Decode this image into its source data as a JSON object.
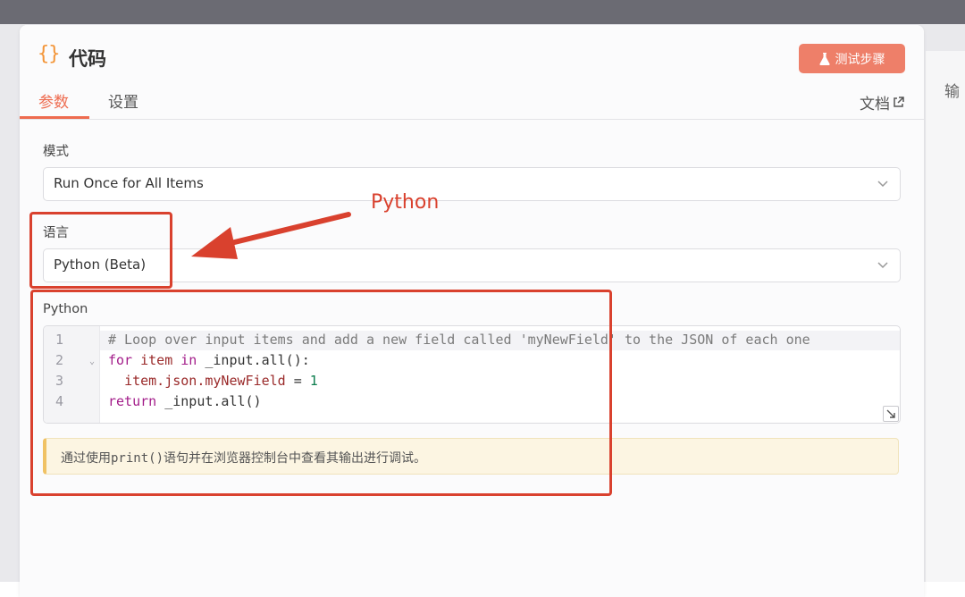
{
  "panel": {
    "title_icon": "{}",
    "title": "代码",
    "test_button": "测试步骤",
    "tabs": [
      "参数",
      "设置"
    ],
    "docs_link": "文档"
  },
  "right_edge_label": "输",
  "fields": {
    "mode_label": "模式",
    "mode_value": "Run Once for All Items",
    "language_label": "语言",
    "language_value": "Python (Beta)",
    "code_label": "Python"
  },
  "code": {
    "line_numbers": [
      "1",
      "2",
      "3",
      "4"
    ],
    "line1_comment": "# Loop over input items and add a new field called 'myNewField' to the JSON of each one",
    "line2": {
      "kw1": "for",
      "var": "item",
      "kw2": "in",
      "rest": "_input.all():"
    },
    "line3": {
      "var": "item.json.myNewField",
      "op": " = ",
      "num": "1"
    },
    "line4": {
      "kw": "return",
      "rest": "_input.all()"
    }
  },
  "hint": {
    "prefix": "通过使用",
    "code": "print()",
    "suffix": "语句并在浏览器控制台中查看其输出进行调试。"
  },
  "annotation": {
    "label": "Python",
    "color": "#d9412e"
  },
  "colors": {
    "accent": "#ee6b4f",
    "button": "#ee7f69",
    "icon": "#f39538"
  }
}
